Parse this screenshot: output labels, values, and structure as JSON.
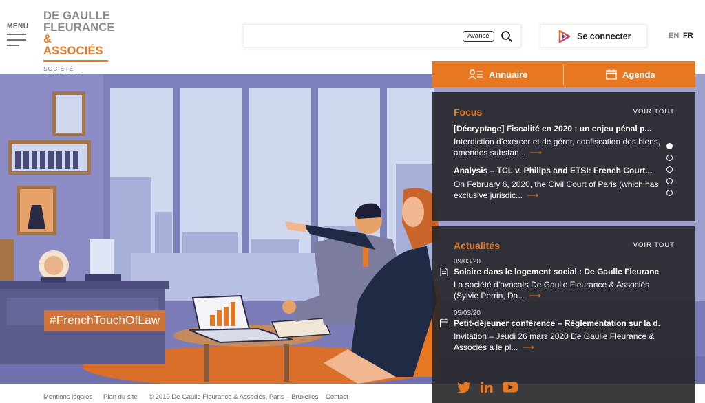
{
  "header": {
    "menu_label": "MENU",
    "logo": {
      "line1": "DE GAULLE",
      "line2": "FLEURANCE",
      "line3": "& ASSOCIÉS",
      "subtitle": "SOCIÉTÉ D'AVOCATS"
    },
    "search": {
      "placeholder": "",
      "value": "",
      "advanced_label": "Avancé"
    },
    "connect_label": "Se connecter",
    "languages": [
      "EN",
      "FR"
    ],
    "active_language": "FR"
  },
  "quick_access": {
    "directory_label": "Annuaire",
    "agenda_label": "Agenda"
  },
  "hero": {
    "hashtag": "#FrenchTouchOfLaw"
  },
  "focus": {
    "title": "Focus",
    "view_all": "VOIR TOUT",
    "items": [
      {
        "title": "[Décryptage] Fiscalité en 2020 : un enjeu pénal p...",
        "description": "Interdiction d’exercer et de gérer, confiscation des biens, amendes substan..."
      },
      {
        "title": "Analysis – TCL v. Philips and ETSI: French Court...",
        "description": "On February 6, 2020, the Civil Court of Paris (which has exclusive jurisdic..."
      }
    ],
    "carousel_total": 5,
    "carousel_active": 1
  },
  "news": {
    "title": "Actualités",
    "view_all": "VOIR TOUT",
    "items": [
      {
        "date": "09/03/20",
        "icon": "document-icon",
        "title": "Solaire dans le logement social : De Gaulle Fleuranc...",
        "description": "La société d’avocats De Gaulle Fleurance & Associés (Sylvie Perrin, Da..."
      },
      {
        "date": "05/03/20",
        "icon": "calendar-icon",
        "title": "Petit-déjeuner conférence – Réglementation sur la d...",
        "description": "Invitation – Jeudi 26 mars 2020 De Gaulle Fleurance & Associés a le pl..."
      }
    ]
  },
  "social": [
    "twitter-icon",
    "linkedin-icon",
    "youtube-icon"
  ],
  "footer": {
    "legal": "Mentions légales",
    "sitemap": "Plan du site",
    "copyright": "© 2019 De Gaulle Fleurance & Associés, Paris – Bruxelles",
    "contact": "Contact"
  },
  "colors": {
    "accent": "#e87722",
    "panel_bg": "#262628",
    "hero_bg": "#8d8dc8"
  }
}
